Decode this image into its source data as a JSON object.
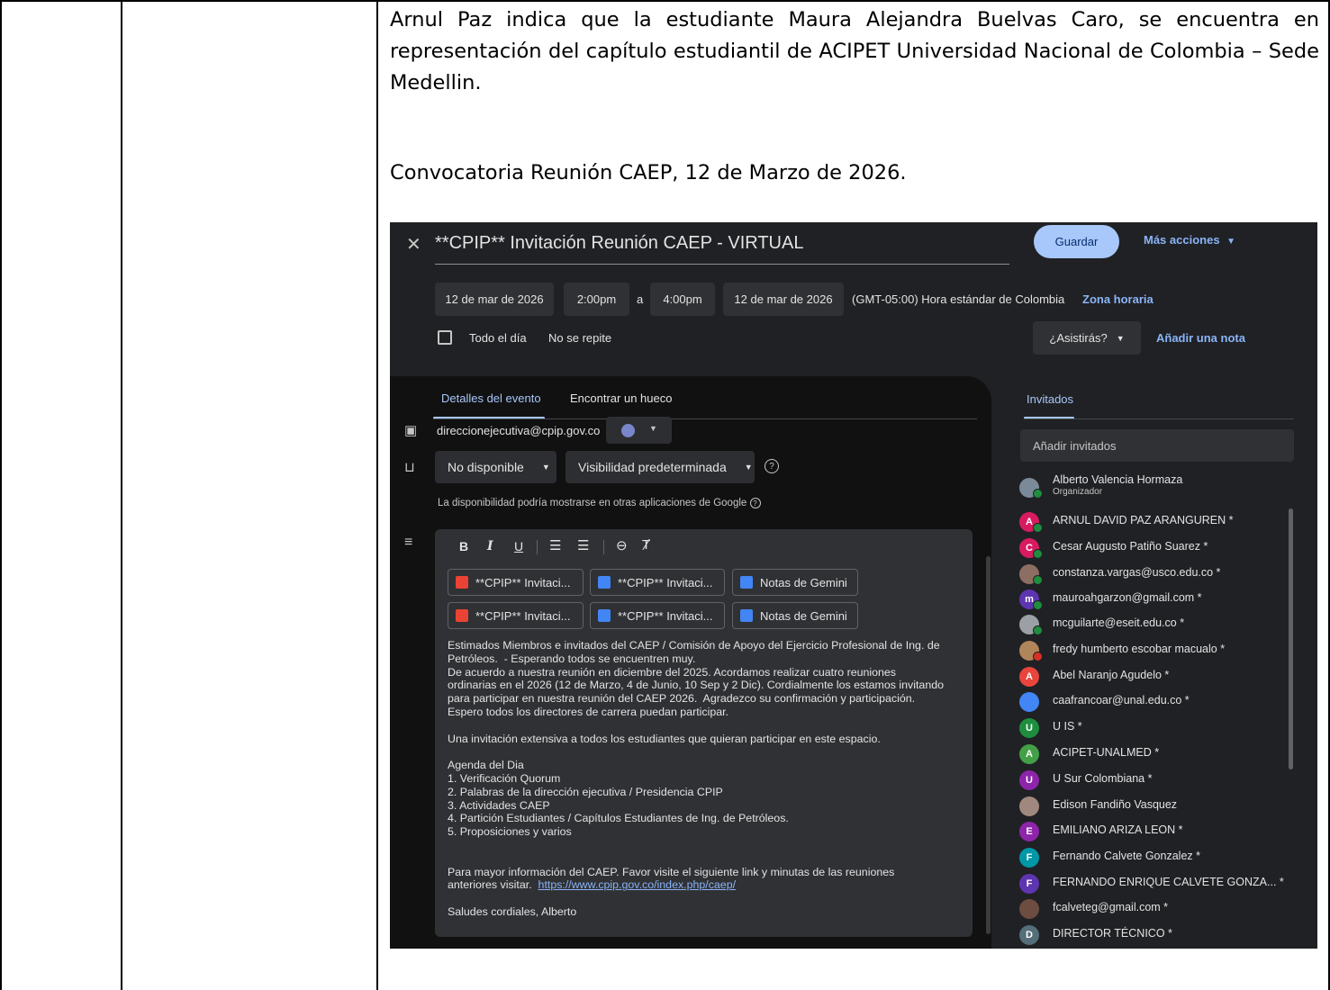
{
  "document": {
    "paragraph1": "Arnul Paz indica que la estudiante Maura Alejandra Buelvas Caro, se encuentra en representación del capítulo estudiantil de ACIPET Universidad Nacional de Colombia – Sede Medellin.",
    "paragraph2": "Convocatoria Reunión CAEP, 12 de Marzo de 2026."
  },
  "event": {
    "title": "**CPIP** Invitación Reunión CAEP - VIRTUAL",
    "save_label": "Guardar",
    "more_actions_label": "Más acciones",
    "start_date": "12 de mar de 2026",
    "start_time": "2:00pm",
    "to_label": "a",
    "end_time": "4:00pm",
    "end_date": "12 de mar de 2026",
    "timezone_text": "(GMT-05:00) Hora estándar de Colombia",
    "timezone_link": "Zona horaria",
    "all_day_label": "Todo el día",
    "repeat_label": "No se repite",
    "attend_label": "¿Asistirás?",
    "add_note_label": "Añadir una nota"
  },
  "details": {
    "tab_details": "Detalles del evento",
    "tab_find_slot": "Encontrar un hueco",
    "calendar_email": "direccionejecutiva@cpip.gov.co",
    "calendar_color": "#7986cb",
    "availability": "No disponible",
    "visibility": "Visibilidad predeterminada",
    "availability_note": "La disponibilidad podría mostrarse en otras aplicaciones de Google",
    "attachments": [
      {
        "label": "**CPIP** Invitaci...",
        "icon": "meet-recording-icon",
        "color": "#ea4335"
      },
      {
        "label": "**CPIP** Invitaci...",
        "icon": "docs-icon",
        "color": "#4285f4"
      },
      {
        "label": "Notas de Gemini",
        "icon": "docs-icon",
        "color": "#4285f4"
      },
      {
        "label": "**CPIP** Invitaci...",
        "icon": "meet-recording-icon",
        "color": "#ea4335"
      },
      {
        "label": "**CPIP** Invitaci...",
        "icon": "docs-icon",
        "color": "#4285f4"
      },
      {
        "label": "Notas de Gemini",
        "icon": "docs-icon",
        "color": "#4285f4"
      }
    ],
    "description": "Estimados Miembros e invitados del CAEP / Comisión de Apoyo del Ejercicio Profesional de Ing. de\nPetróleos.  - Esperando todos se encuentren muy.\nDe acuerdo a nuestra reunión en diciembre del 2025. Acordamos realizar cuatro reuniones\nordinarias en el 2026 (12 de Marzo, 4 de Junio, 10 Sep y 2 Dic). Cordialmente los estamos invitando\npara participar en nuestra reunión del CAEP 2026.  Agradezco su confirmación y participación.\nEspero todos los directores de carrera puedan participar.\n\nUna invitación extensiva a todos los estudiantes que quieran participar en este espacio.\n\nAgenda del Dia\n1. Verificación Quorum\n2. Palabras de la dirección ejecutiva / Presidencia CPIP\n3. Actividades CAEP\n4. Partición Estudiantes / Capítulos Estudiantes de Ing. de Petróleos.\n5. Proposiciones y varios\n\n\nPara mayor información del CAEP. Favor visite el siguiente link y minutas de las reuniones\nanteriores visitar.  ",
    "link": "https://www.cpip.gov.co/index.php/caep/",
    "closing": "Saludes cordiales, Alberto"
  },
  "guests": {
    "tab_label": "Invitados",
    "add_placeholder": "Añadir invitados",
    "organizer_label": "Organizador",
    "list": [
      {
        "name": "Alberto Valencia Hormaza",
        "initial": "",
        "color": "#7a8a99",
        "status": "accepted"
      },
      {
        "name": "ARNUL DAVID PAZ ARANGUREN *",
        "initial": "A",
        "color": "#d81b60",
        "status": "accepted"
      },
      {
        "name": "Cesar Augusto Patiño Suarez *",
        "initial": "C",
        "color": "#d81b60",
        "status": "accepted"
      },
      {
        "name": "constanza.vargas@usco.edu.co *",
        "initial": "",
        "color": "#8d6e63",
        "status": "accepted"
      },
      {
        "name": "mauroahgarzon@gmail.com *",
        "initial": "m",
        "color": "#5e35b1",
        "status": "accepted"
      },
      {
        "name": "mcguilarte@eseit.edu.co *",
        "initial": "",
        "color": "#9aa0a6",
        "status": "accepted"
      },
      {
        "name": "fredy humberto escobar macualo *",
        "initial": "",
        "color": "#b0855a",
        "status": "declined"
      },
      {
        "name": "Abel Naranjo Agudelo *",
        "initial": "A",
        "color": "#e8453c",
        "status": "none"
      },
      {
        "name": "caafrancoar@unal.edu.co *",
        "initial": "",
        "color": "#4285f4",
        "status": "none"
      },
      {
        "name": "U IS *",
        "initial": "U",
        "color": "#1e8e3e",
        "status": "none"
      },
      {
        "name": "ACIPET-UNALMED *",
        "initial": "A",
        "color": "#43a047",
        "status": "none"
      },
      {
        "name": "U Sur Colombiana *",
        "initial": "U",
        "color": "#8e24aa",
        "status": "none"
      },
      {
        "name": "Edison Fandiño Vasquez",
        "initial": "",
        "color": "#a1887f",
        "status": "none"
      },
      {
        "name": "EMILIANO ARIZA LEON *",
        "initial": "E",
        "color": "#8e24aa",
        "status": "none"
      },
      {
        "name": "Fernando Calvete Gonzalez *",
        "initial": "F",
        "color": "#0097a7",
        "status": "none"
      },
      {
        "name": "FERNANDO ENRIQUE CALVETE GONZA... *",
        "initial": "F",
        "color": "#5e35b1",
        "status": "none"
      },
      {
        "name": "fcalveteg@gmail.com *",
        "initial": "",
        "color": "#6d4c41",
        "status": "none"
      },
      {
        "name": "DIRECTOR TÉCNICO *",
        "initial": "D",
        "color": "#546e7a",
        "status": "none"
      }
    ]
  }
}
